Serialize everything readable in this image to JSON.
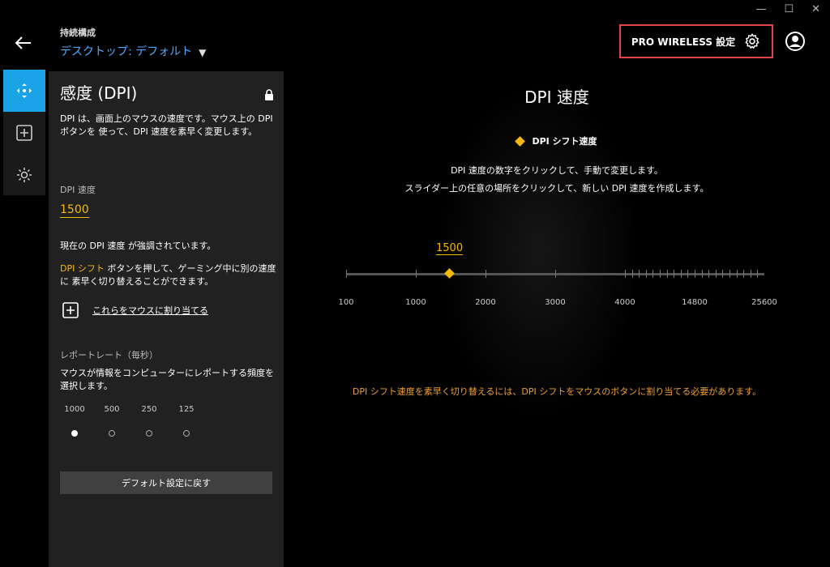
{
  "window": {
    "minimize": "—",
    "maximize": "☐",
    "close": "✕"
  },
  "header": {
    "profile_label": "持続構成",
    "profile_value": "デスクトップ: デフォルト",
    "device_settings": "PRO WIRELESS 設定"
  },
  "panel": {
    "title": "感度 (DPI)",
    "description": "DPI は、画面上のマウスの速度です。マウス上の DPI ボタンを 使って、DPI 速度を素早く変更します。",
    "dpi_speed_label": "DPI 速度",
    "dpi_speed_value": "1500",
    "highlight_note": "現在の DPI 速度 が強調されています。",
    "shift_note_accent": "DPI シフト",
    "shift_note_rest": " ボタンを押して、ゲーミング中に別の速度に 素早く切り替えることができます。",
    "assign_link": "これらをマウスに割り当てる",
    "report_rate_label": "レポートレート（毎秒）",
    "report_rate_desc": "マウスが情報をコンピューターにレポートする頻度を選択します。",
    "report_rates": [
      "1000",
      "500",
      "250",
      "125"
    ],
    "selected_report_rate": "1000",
    "reset_button": "デフォルト設定に戻す"
  },
  "main": {
    "title": "DPI 速度",
    "legend": "DPI シフト速度",
    "instruction_1": "DPI 速度の数字をクリックして、手動で変更します。",
    "instruction_2": "スライダー上の任意の場所をクリックして、新しい DPI 速度を作成します。",
    "current_dpi": "1500",
    "scale_labels": [
      "100",
      "1000",
      "2000",
      "3000",
      "4000",
      "14800",
      "25600"
    ],
    "warning": "DPI シフト速度を素早く切り替えるには、DPI シフトをマウスのボタンに割り当てる必要があります。"
  },
  "colors": {
    "accent": "#1aa3e6",
    "dpi": "#f5b90c",
    "highlight_box": "#e0434c",
    "warning": "#f0a030"
  }
}
